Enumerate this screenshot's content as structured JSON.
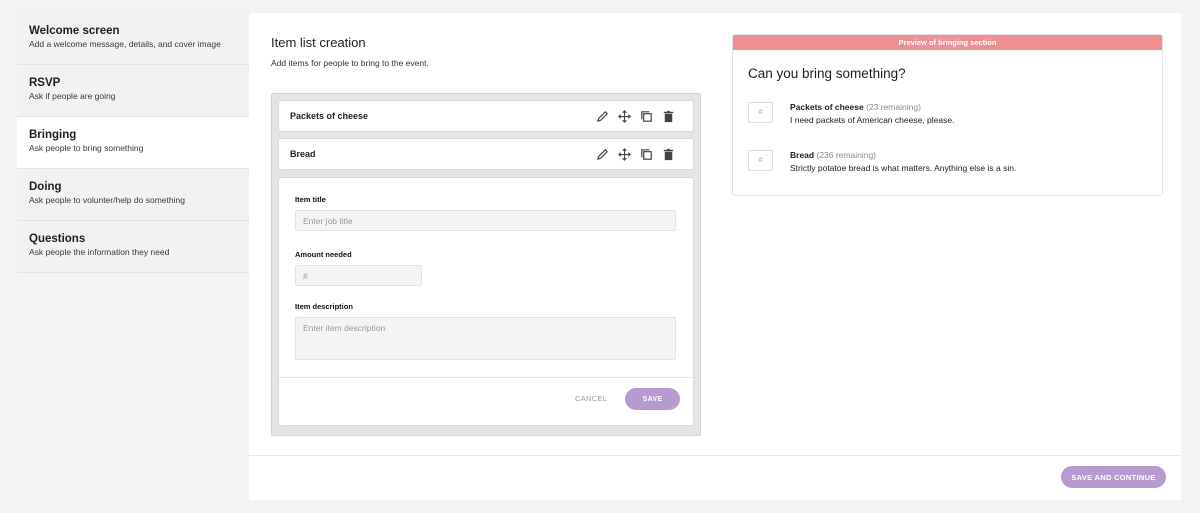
{
  "sidebar": {
    "items": [
      {
        "title": "Welcome screen",
        "desc": "Add a welcome message, details, and cover image"
      },
      {
        "title": "RSVP",
        "desc": "Ask if people are going"
      },
      {
        "title": "Bringing",
        "desc": "Ask people to bring something"
      },
      {
        "title": "Doing",
        "desc": "Ask people to volunter/help do something"
      },
      {
        "title": "Questions",
        "desc": "Ask people the information they need"
      }
    ]
  },
  "editor": {
    "title": "Item list creation",
    "subtitle": "Add items for people to bring to the event.",
    "items": [
      {
        "name": "Packets of cheese"
      },
      {
        "name": "Bread"
      }
    ],
    "form": {
      "title_label": "Item title",
      "title_placeholder": "Enter job title",
      "amount_label": "Amount needed",
      "amount_placeholder": "#",
      "desc_label": "Item description",
      "desc_placeholder": "Enter item description",
      "cancel_label": "CANCEL",
      "save_label": "SAVE"
    },
    "row_icons": [
      "pencil-icon",
      "move-icon",
      "duplicate-icon",
      "trash-icon"
    ]
  },
  "preview": {
    "banner": "Preview of bringing section",
    "title": "Can you bring something?",
    "items": [
      {
        "hash": "#",
        "name": "Packets of cheese",
        "remaining": "(23 remaining)",
        "desc": "I need packets of American cheese, please."
      },
      {
        "hash": "#",
        "name": "Bread",
        "remaining": "(236 remaining)",
        "desc": "Strictly potatoe bread is what matters. Anything else is a sin."
      }
    ]
  },
  "footer": {
    "save_continue_label": "SAVE AND CONTINUE"
  },
  "colors": {
    "accent_purple": "#b79ad0",
    "preview_banner": "#f08f94"
  }
}
